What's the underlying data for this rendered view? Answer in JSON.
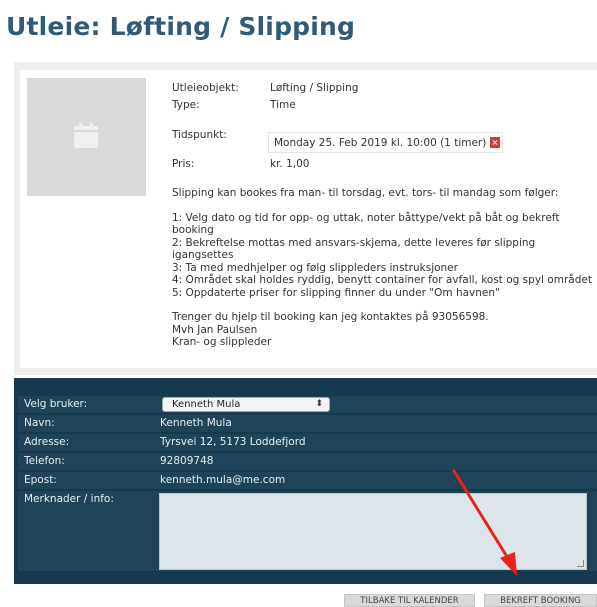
{
  "page": {
    "title": "Utleie: Løfting / Slipping"
  },
  "details": {
    "object_label": "Utleieobjekt:",
    "object_value": "Løfting / Slipping",
    "type_label": "Type:",
    "type_value": "Time",
    "time_label": "Tidspunkt:",
    "time_value": "Monday 25. Feb 2019 kl. 10:00 (1 timer)",
    "remove_symbol": "×",
    "price_label": "Pris:",
    "price_value": "kr. 1,00"
  },
  "description": {
    "intro": "Slipping kan bookes fra man- til torsdag, evt. tors- til mandag som følger:",
    "steps": [
      "1: Velg dato og tid for opp- og uttak, noter båttype/vekt på båt og bekreft booking",
      "2: Bekreftelse mottas med ansvars-skjema, dette leveres før slipping igangsettes",
      "3: Ta med medhjelper og følg slippleders instruksjoner",
      "4: Området skal holdes ryddig, benytt container for avfall, kost og spyl området",
      "5: Oppdaterte priser for slipping finner du under \"Om havnen\""
    ],
    "contact_line": "Trenger du hjelp til booking kan jeg kontaktes på 93056598.",
    "sign_1": "Mvh Jan Paulsen",
    "sign_2": "Kran- og slippleder"
  },
  "user_form": {
    "select_label": "Velg bruker:",
    "select_value": "Kenneth Mula",
    "name_label": "Navn:",
    "name_value": "Kenneth Mula",
    "address_label": "Adresse:",
    "address_value": "Tyrsvei 12, 5173 Loddefjord",
    "phone_label": "Telefon:",
    "phone_value": "92809748",
    "email_label": "Epost:",
    "email_value": "kenneth.mula@me.com",
    "notes_label": "Merknader / info:",
    "notes_value": ""
  },
  "buttons": {
    "back": "TILBAKE TIL KALENDER",
    "confirm": "BEKREFT BOOKING"
  },
  "colors": {
    "title": "#2f5a78",
    "panel_dark": "#17394d",
    "arrow": "#e8231c",
    "remove": "#d63b3b"
  }
}
